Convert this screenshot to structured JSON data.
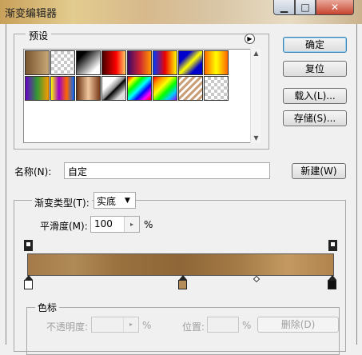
{
  "window": {
    "title": "渐变编辑器",
    "minimize": "▁",
    "maximize": "□",
    "close": "✕"
  },
  "presets": {
    "label": "预设",
    "menu_icon": "arrow-menu-icon",
    "scroll_up": "▲",
    "scroll_down": "▼",
    "swatches": [
      {
        "name": "foreground-to-background",
        "bg": "linear-gradient(90deg,#7a5530,#c8a878)"
      },
      {
        "name": "foreground-to-transparent",
        "bg": "checker-fade"
      },
      {
        "name": "black-white",
        "bg": "linear-gradient(135deg,#000 20%,#fff 80%)"
      },
      {
        "name": "red",
        "bg": "linear-gradient(90deg,#400,#f00 60%,#fc6)"
      },
      {
        "name": "violet-orange",
        "bg": "linear-gradient(90deg,#3a0a6a,#c23,#f90)"
      },
      {
        "name": "blue-red-yellow",
        "bg": "linear-gradient(90deg,#0038ff,#e00 50%,#ff0)"
      },
      {
        "name": "blue-yellow-blue",
        "bg": "linear-gradient(135deg,#00c 25%,#ff0 50%,#00c 75%)"
      },
      {
        "name": "orange-yellow-orange",
        "bg": "linear-gradient(90deg,#f60,#ff0 50%,#f60)"
      },
      {
        "name": "violet-green-orange",
        "bg": "linear-gradient(90deg,#60c,#393 50%,#f90)"
      },
      {
        "name": "yellow-violet-orange-blue",
        "bg": "linear-gradient(90deg,#ff0,#90c,#f60,#06f)"
      },
      {
        "name": "copper",
        "bg": "linear-gradient(90deg,#6a3010,#f0c8a0 50%,#7a3a18)"
      },
      {
        "name": "chrome",
        "bg": "linear-gradient(135deg,#fff 30%,#888 50%,#000 55%,#ddd 80%)"
      },
      {
        "name": "spectrum",
        "bg": "linear-gradient(135deg,#f00,#ff0,#0f0,#0ff,#00f,#f0f,#f00)"
      },
      {
        "name": "transparent-rainbow",
        "bg": "linear-gradient(135deg,#f00,#f90,#ff0,#0f0,#0cf,#90f)"
      },
      {
        "name": "transparent-stripes",
        "bg": "repeating-linear-gradient(135deg,#caa07a 0 3px,#fff 3px 6px)"
      },
      {
        "name": "transparent",
        "bg": "checker"
      }
    ]
  },
  "buttons": {
    "ok": "确定",
    "reset": "复位",
    "load": "载入(L)...",
    "save": "存储(S)...",
    "new": "新建(W)",
    "delete": "删除(D)"
  },
  "name": {
    "label": "名称(N):",
    "value": "自定"
  },
  "gradient_type": {
    "label": "渐变类型(T):",
    "value": "实底",
    "arrow": "▼"
  },
  "smoothness": {
    "label": "平滑度(M):",
    "value": "100",
    "unit": "%",
    "arrow": "▸"
  },
  "gradient_colors": [
    "#a37a48",
    "#b08a56",
    "#99713f",
    "#8e6637",
    "#a57c47",
    "#c49a62",
    "#b0844c"
  ],
  "color_stops": [
    "#fff",
    "#b48b5a",
    "#111"
  ],
  "stops": {
    "title": "色标",
    "opacity_label": "不透明度:",
    "opacity_unit": "%",
    "opacity_arrow": "▸",
    "location_label": "位置:",
    "location_unit": "%"
  }
}
